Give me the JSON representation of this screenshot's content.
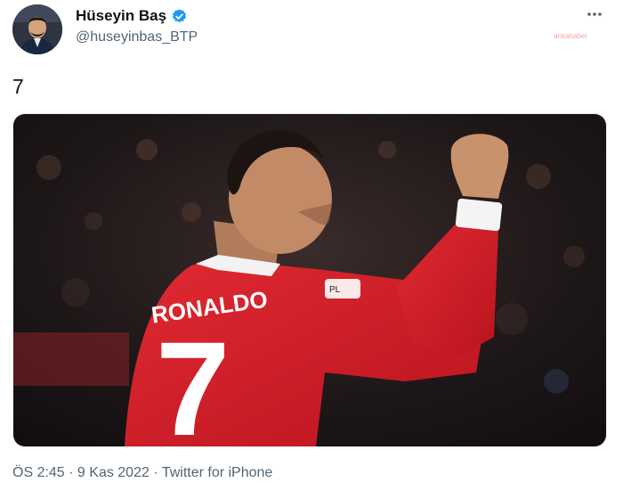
{
  "author": {
    "name": "Hüseyin Baş",
    "handle": "@huseyinbas_BTP",
    "verified": true
  },
  "more_icon": "more-horizontal-icon",
  "watermark": "ankahaber",
  "tweet": {
    "text": "7"
  },
  "media": {
    "jersey_name": "RONALDO",
    "jersey_number": "7",
    "colors": {
      "jersey": "#d1202a",
      "sleeve_cuff": "#f4f4f4",
      "background": "#1f1a1a"
    }
  },
  "meta": {
    "time": "ÖS 2:45",
    "separator": " · ",
    "date": "9 Kas 2022",
    "source": "Twitter for iPhone"
  },
  "colors": {
    "verified_blue": "#1d9bf0",
    "secondary_text": "#536471"
  }
}
